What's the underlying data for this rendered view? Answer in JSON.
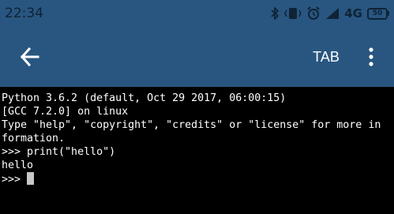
{
  "status_bar": {
    "time": "22:34",
    "network_type": "4G",
    "battery_level": "50",
    "icons": [
      "bluetooth-icon",
      "vibrate-icon",
      "alarm-icon",
      "signal-icon",
      "battery-icon"
    ]
  },
  "app_bar": {
    "back_icon": "arrow-left-icon",
    "tab_label": "TAB",
    "menu_icon": "more-vert-icon"
  },
  "terminal": {
    "lines": [
      "Python 3.6.2 (default, Oct 29 2017, 06:00:15)",
      "[GCC 7.2.0] on linux",
      "Type \"help\", \"copyright\", \"credits\" or \"license\" for more in",
      "formation.",
      ">>> print(\"hello\")",
      "hello"
    ],
    "prompt": ">>> "
  },
  "colors": {
    "app_bar_background": "#295680",
    "status_icons": "#0e2336",
    "terminal_background": "#000000",
    "terminal_text": "#ffffff",
    "cursor": "#c8c8c8"
  }
}
